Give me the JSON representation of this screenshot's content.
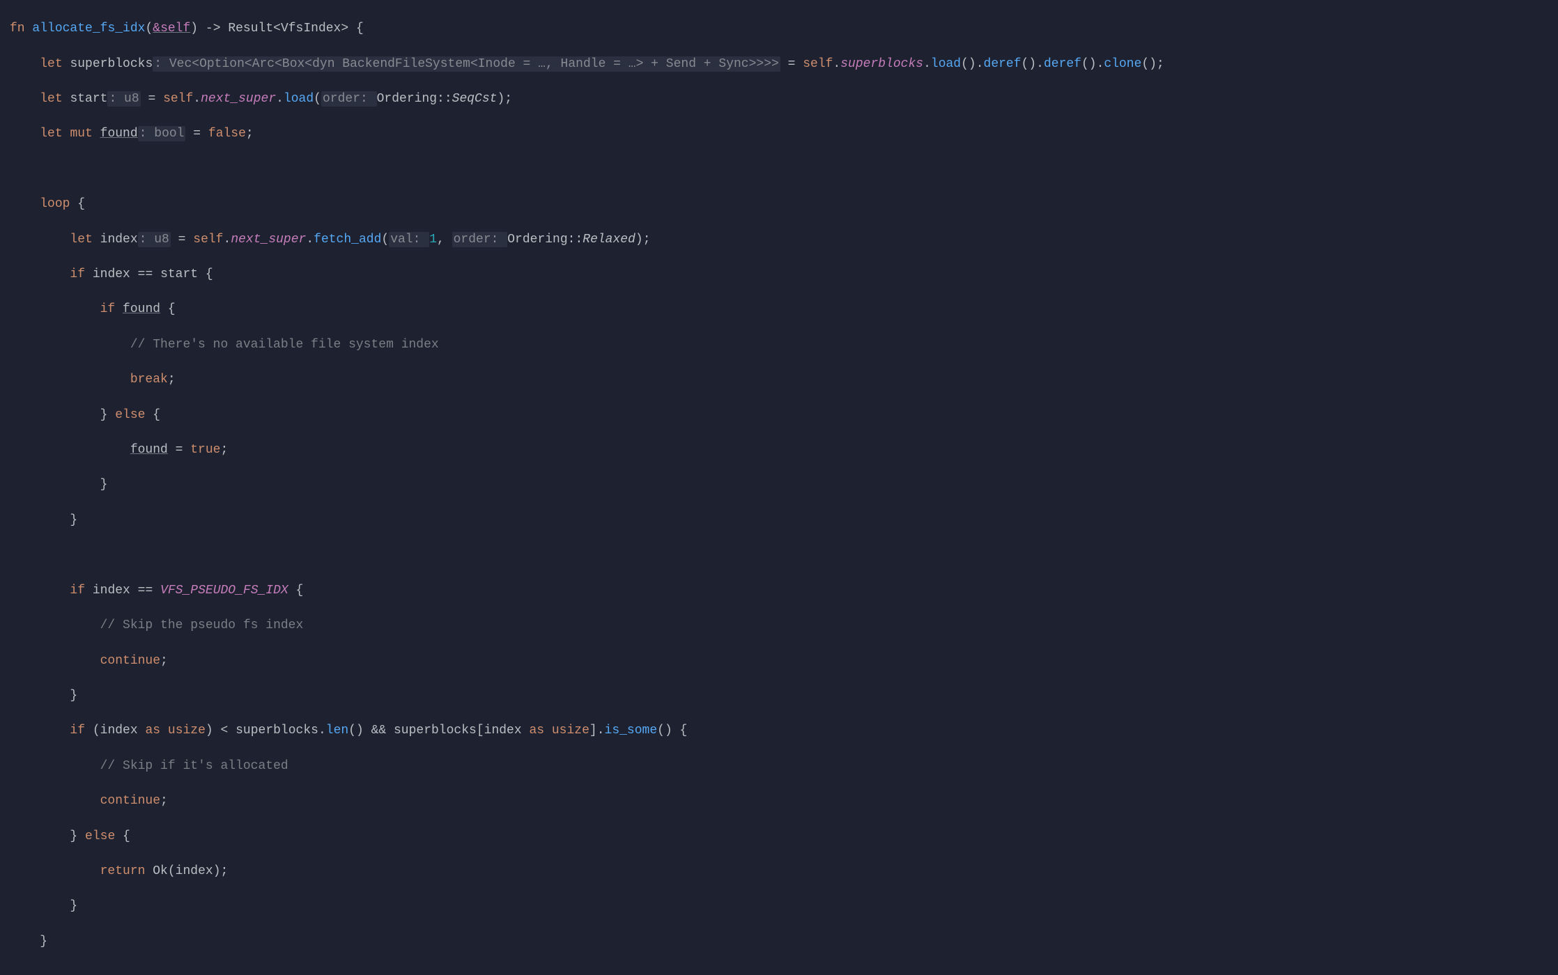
{
  "theme": {
    "background": "#1e2230",
    "keyword": "#cf8e6d",
    "function": "#56a8f5",
    "comment": "#7a7e85",
    "hint": "#868a91",
    "number": "#2aacb8",
    "constant": "#c77dbb"
  },
  "language": "Rust",
  "function_signature": {
    "fn_kw": "fn",
    "name": "allocate_fs_idx",
    "self_param": "&self",
    "arrow": "->",
    "return_type": "Result<VfsIndex>",
    "open_brace": "{"
  },
  "lines": {
    "l2": {
      "let": "let",
      "var": "superblocks",
      "hint_type": ": Vec<Option<Arc<Box<dyn BackendFileSystem<Inode = …, Handle = …> + Send + Sync>>>>",
      "eq": " = ",
      "self": "self",
      "dot1": ".",
      "f1": "superblocks",
      "dot2": ".",
      "m1": "load",
      "p1": "()",
      "dot3": ".",
      "m2": "deref",
      "p2": "()",
      "dot4": ".",
      "m3": "deref",
      "p3": "()",
      "dot5": ".",
      "m4": "clone",
      "p4": "();"
    },
    "l3": {
      "let": "let",
      "var": "start",
      "hint_type": ": u8",
      "eq": " = ",
      "self": "self",
      "dot1": ".",
      "f1": "next_super",
      "dot2": ".",
      "m1": "load",
      "paren_o": "(",
      "hint_arg": "order: ",
      "enum1": "Ordering",
      "sep": "::",
      "variant": "SeqCst",
      "paren_c": ");"
    },
    "l4": {
      "let": "let",
      "mut": "mut",
      "var": "found",
      "hint_type": ": bool",
      "eq": " = ",
      "val": "false",
      "semi": ";"
    },
    "l6": {
      "loop": "loop",
      "brace": " {"
    },
    "l7": {
      "let": "let",
      "var": "index",
      "hint_type": ": u8",
      "eq": " = ",
      "self": "self",
      "dot1": ".",
      "f1": "next_super",
      "dot2": ".",
      "m1": "fetch_add",
      "paren_o": "(",
      "hint_a1": "val: ",
      "num": "1",
      "comma": ", ",
      "hint_a2": "order: ",
      "enum1": "Ordering",
      "sep": "::",
      "variant": "Relaxed",
      "paren_c": ");"
    },
    "l8": {
      "if": "if",
      "lhs": "index",
      "op": " == ",
      "rhs": "start",
      "brace": " {"
    },
    "l9": {
      "if": "if",
      "var": "found",
      "brace": " {"
    },
    "l10": {
      "cmt": "// There's no available file system index"
    },
    "l11": {
      "break": "break",
      "semi": ";"
    },
    "l12": {
      "close": "}",
      "else": " else ",
      "open": "{"
    },
    "l13": {
      "var": "found",
      "eq": " = ",
      "val": "true",
      "semi": ";"
    },
    "l14": {
      "close": "}"
    },
    "l15": {
      "close": "}"
    },
    "l17": {
      "if": "if",
      "lhs": "index",
      "op": " == ",
      "rhs": "VFS_PSEUDO_FS_IDX",
      "brace": " {"
    },
    "l18": {
      "cmt": "// Skip the pseudo fs index"
    },
    "l19": {
      "continue": "continue",
      "semi": ";"
    },
    "l20": {
      "close": "}"
    },
    "l21": {
      "if": "if",
      "paren_o": "(",
      "lhs": "index",
      "as": " as ",
      "usize1": "usize",
      "paren_c": ")",
      "lt": " < ",
      "sb": "superblocks",
      "dot": ".",
      "len": "len",
      "lp": "()",
      "and": " && ",
      "sb2": "superblocks",
      "bo": "[",
      "idx": "index",
      "as2": " as ",
      "usize2": "usize",
      "bc": "]",
      "dot2": ".",
      "some": "is_some",
      "sp": "()",
      "brace": " {"
    },
    "l22": {
      "cmt": "// Skip if it's allocated"
    },
    "l23": {
      "continue": "continue",
      "semi": ";"
    },
    "l24": {
      "close": "}",
      "else": " else ",
      "open": "{"
    },
    "l25": {
      "return": "return",
      "ok": "Ok",
      "po": "(",
      "arg": "index",
      "pc": ");"
    },
    "l26": {
      "close": "}"
    },
    "l27": {
      "close": "}"
    }
  }
}
